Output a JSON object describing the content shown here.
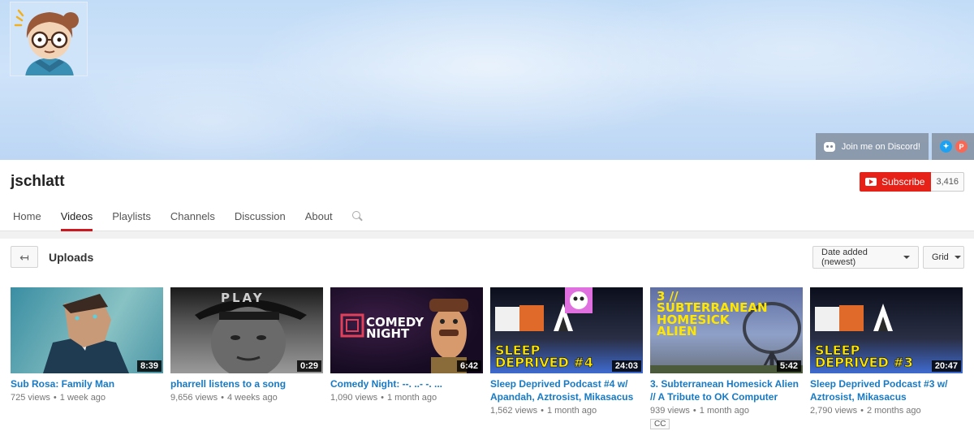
{
  "channel": {
    "name": "jschlatt",
    "subscribe_label": "Subscribe",
    "subscriber_count": "3,416"
  },
  "banner": {
    "discord_label": "Join me on Discord!",
    "social_icons": [
      "twitter-icon",
      "patreon-icon"
    ]
  },
  "tabs": [
    {
      "label": "Home",
      "active": false
    },
    {
      "label": "Videos",
      "active": true
    },
    {
      "label": "Playlists",
      "active": false
    },
    {
      "label": "Channels",
      "active": false
    },
    {
      "label": "Discussion",
      "active": false
    },
    {
      "label": "About",
      "active": false
    }
  ],
  "section": {
    "title": "Uploads",
    "sort_label": "Date added (newest)",
    "view_label": "Grid"
  },
  "videos": [
    {
      "title": "Sub Rosa: Family Man",
      "duration": "8:39",
      "views": "725 views",
      "age": "1 week ago",
      "cc": ""
    },
    {
      "title": "pharrell listens to a song",
      "duration": "0:29",
      "views": "9,656 views",
      "age": "4 weeks ago",
      "cc": ""
    },
    {
      "title": "Comedy Night: --. ..- -. ...",
      "duration": "6:42",
      "views": "1,090 views",
      "age": "1 month ago",
      "cc": ""
    },
    {
      "title": "Sleep Deprived Podcast #4 w/ Apandah, Aztrosist, Mikasacus",
      "duration": "24:03",
      "views": "1,562 views",
      "age": "1 month ago",
      "cc": ""
    },
    {
      "title": "3. Subterranean Homesick Alien // A Tribute to OK Computer",
      "duration": "5:42",
      "views": "939 views",
      "age": "1 month ago",
      "cc": "CC"
    },
    {
      "title": "Sleep Deprived Podcast #3 w/ Aztrosist, Mikasacus",
      "duration": "20:47",
      "views": "2,790 views",
      "age": "2 months ago",
      "cc": ""
    }
  ],
  "thumbnail_text": {
    "t2": "PLAY",
    "t3": "COMEDY\nNIGHT",
    "t4": "SLEEP\nDEPRIVED #4",
    "t5": "3 //\nSUBTERRANEAN\nHOMESICK\nALIEN",
    "t6": "SLEEP\nDEPRIVED #3"
  },
  "colors": {
    "accent_red": "#e62117",
    "link_blue": "#167ac6",
    "tab_underline": "#cc181e"
  }
}
